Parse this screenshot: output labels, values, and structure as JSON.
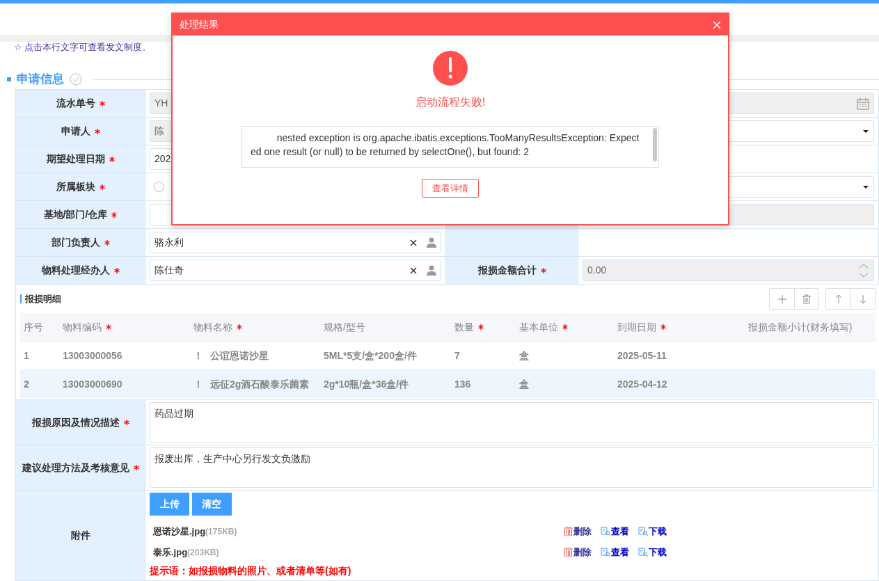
{
  "notice": "☆ 点击本行文字可查看发文制度。",
  "section_title": "申请信息",
  "form_rows": [
    {
      "label": "流水单号",
      "required": true,
      "span": true,
      "field": {
        "kind": "date",
        "value": "YH",
        "disabled": true
      }
    },
    {
      "label": "申请人",
      "required": true,
      "field": {
        "kind": "text",
        "value": "陈",
        "disabled": true
      },
      "right": {
        "field": {
          "kind": "select",
          "disabled": false
        }
      }
    },
    {
      "label": "期望处理日期",
      "required": true,
      "field": {
        "kind": "text",
        "value": "202",
        "disabled": false
      }
    },
    {
      "label": "所属板块",
      "required": true,
      "field": {
        "kind": "radio",
        "options": [
          {
            "selected": false
          }
        ]
      },
      "right": {
        "field": {
          "kind": "select",
          "disabled": false
        }
      }
    },
    {
      "label": "基地/部门/仓库",
      "required": true,
      "field": {
        "kind": "person",
        "disabled": false
      },
      "right": {
        "field": {
          "kind": "text",
          "disabled": true
        }
      }
    },
    {
      "label": "部门负责人",
      "required": true,
      "field": {
        "kind": "person",
        "value": "骆永利",
        "disabled": false
      }
    },
    {
      "label": "物料处理经办人",
      "required": true,
      "field": {
        "kind": "person",
        "value": "陈仕奇",
        "disabled": false
      },
      "right": {
        "label": "报损金额合计",
        "required": true,
        "field": {
          "kind": "number",
          "value": "0.00",
          "disabled": true
        }
      }
    }
  ],
  "detail": {
    "title": "报损明细",
    "columns": [
      {
        "label": "序号",
        "required": false
      },
      {
        "label": "物料编码",
        "required": true
      },
      {
        "label": "物料名称",
        "required": true
      },
      {
        "label": "规格/型号",
        "required": false
      },
      {
        "label": "数量",
        "required": true
      },
      {
        "label": "基本单位",
        "required": true
      },
      {
        "label": "到期日期",
        "required": true
      },
      {
        "label": "报损金额小计(财务填写)",
        "required": false
      }
    ],
    "rows": [
      {
        "selected": false,
        "mark": "！",
        "cells": [
          "1",
          "13003000056",
          "公谊恩诺沙星",
          "5ML*5支/盒*200盒/件",
          "7",
          "盒",
          "2025-05-11",
          ""
        ]
      },
      {
        "selected": true,
        "mark": "！",
        "cells": [
          "2",
          "13003000690",
          "远征2g酒石酸泰乐菌素",
          "2g*10瓶/盒*36盒/件",
          "136",
          "盒",
          "2025-04-12",
          ""
        ]
      }
    ]
  },
  "text_rows": [
    {
      "label": "报损原因及情况描述",
      "required": true,
      "value": "药品过期"
    },
    {
      "label": "建议处理方法及考核意见",
      "required": true,
      "value": "报废出库，生产中心另行发文负激励"
    }
  ],
  "attachments": {
    "label": "附件",
    "buttons": [
      "上传",
      "清空"
    ],
    "files": [
      {
        "name": "恩诺沙星.jpg",
        "size": "(175KB)",
        "actions": [
          {
            "kind": "delete",
            "label": "删除"
          },
          {
            "kind": "view",
            "label": "查看"
          },
          {
            "kind": "download",
            "label": "下载"
          }
        ]
      },
      {
        "name": "泰乐.jpg",
        "size": "(203KB)",
        "actions": [
          {
            "kind": "delete",
            "label": "删除"
          },
          {
            "kind": "view",
            "label": "查看"
          },
          {
            "kind": "download",
            "label": "下载"
          }
        ]
      }
    ],
    "hint": "提示语：如报损物料的照片、或者清单等(如有)"
  },
  "dialog": {
    "title": "处理结果",
    "message": "启动流程失败!",
    "detail": "nested exception is org.apache.ibatis.exceptions.TooManyResultsException: Expected one result (or null) to be returned by selectOne(), but found: 2",
    "button": "查看详情"
  }
}
